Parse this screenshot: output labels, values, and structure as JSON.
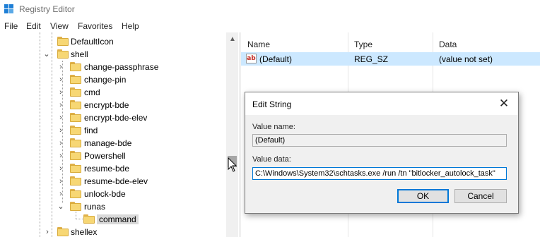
{
  "window": {
    "title": "Registry Editor",
    "icon": "registry-editor-icon"
  },
  "menu": [
    "File",
    "Edit",
    "View",
    "Favorites",
    "Help"
  ],
  "tree": {
    "items": [
      {
        "label": "DefaultIcon",
        "chevron": "",
        "selected": false
      },
      {
        "label": "shell",
        "chevron": "expanded",
        "selected": false
      },
      {
        "label": "change-passphrase",
        "chevron": "collapsed",
        "selected": false
      },
      {
        "label": "change-pin",
        "chevron": "collapsed",
        "selected": false
      },
      {
        "label": "cmd",
        "chevron": "collapsed",
        "selected": false
      },
      {
        "label": "encrypt-bde",
        "chevron": "collapsed",
        "selected": false
      },
      {
        "label": "encrypt-bde-elev",
        "chevron": "collapsed",
        "selected": false
      },
      {
        "label": "find",
        "chevron": "collapsed",
        "selected": false
      },
      {
        "label": "manage-bde",
        "chevron": "collapsed",
        "selected": false
      },
      {
        "label": "Powershell",
        "chevron": "collapsed",
        "selected": false
      },
      {
        "label": "resume-bde",
        "chevron": "collapsed",
        "selected": false
      },
      {
        "label": "resume-bde-elev",
        "chevron": "collapsed",
        "selected": false
      },
      {
        "label": "unlock-bde",
        "chevron": "collapsed",
        "selected": false
      },
      {
        "label": "runas",
        "chevron": "expanded",
        "selected": false
      },
      {
        "label": "command",
        "chevron": "",
        "selected": true
      },
      {
        "label": "shellex",
        "chevron": "collapsed",
        "selected": false
      }
    ]
  },
  "list": {
    "columns": [
      "Name",
      "Type",
      "Data"
    ],
    "rows": [
      {
        "name": "(Default)",
        "type": "REG_SZ",
        "data": "(value not set)",
        "icon": "string-value-icon"
      }
    ]
  },
  "dialog": {
    "title": "Edit String",
    "value_name_label": "Value name:",
    "value_name": "(Default)",
    "value_data_label": "Value data:",
    "value_data": "C:\\Windows\\System32\\schtasks.exe /run  /tn \"bitlocker_autolock_task\"",
    "ok_label": "OK",
    "cancel_label": "Cancel"
  },
  "colors": {
    "selection": "#cce8ff",
    "accent": "#0078d7",
    "folder": "#f7d774"
  }
}
